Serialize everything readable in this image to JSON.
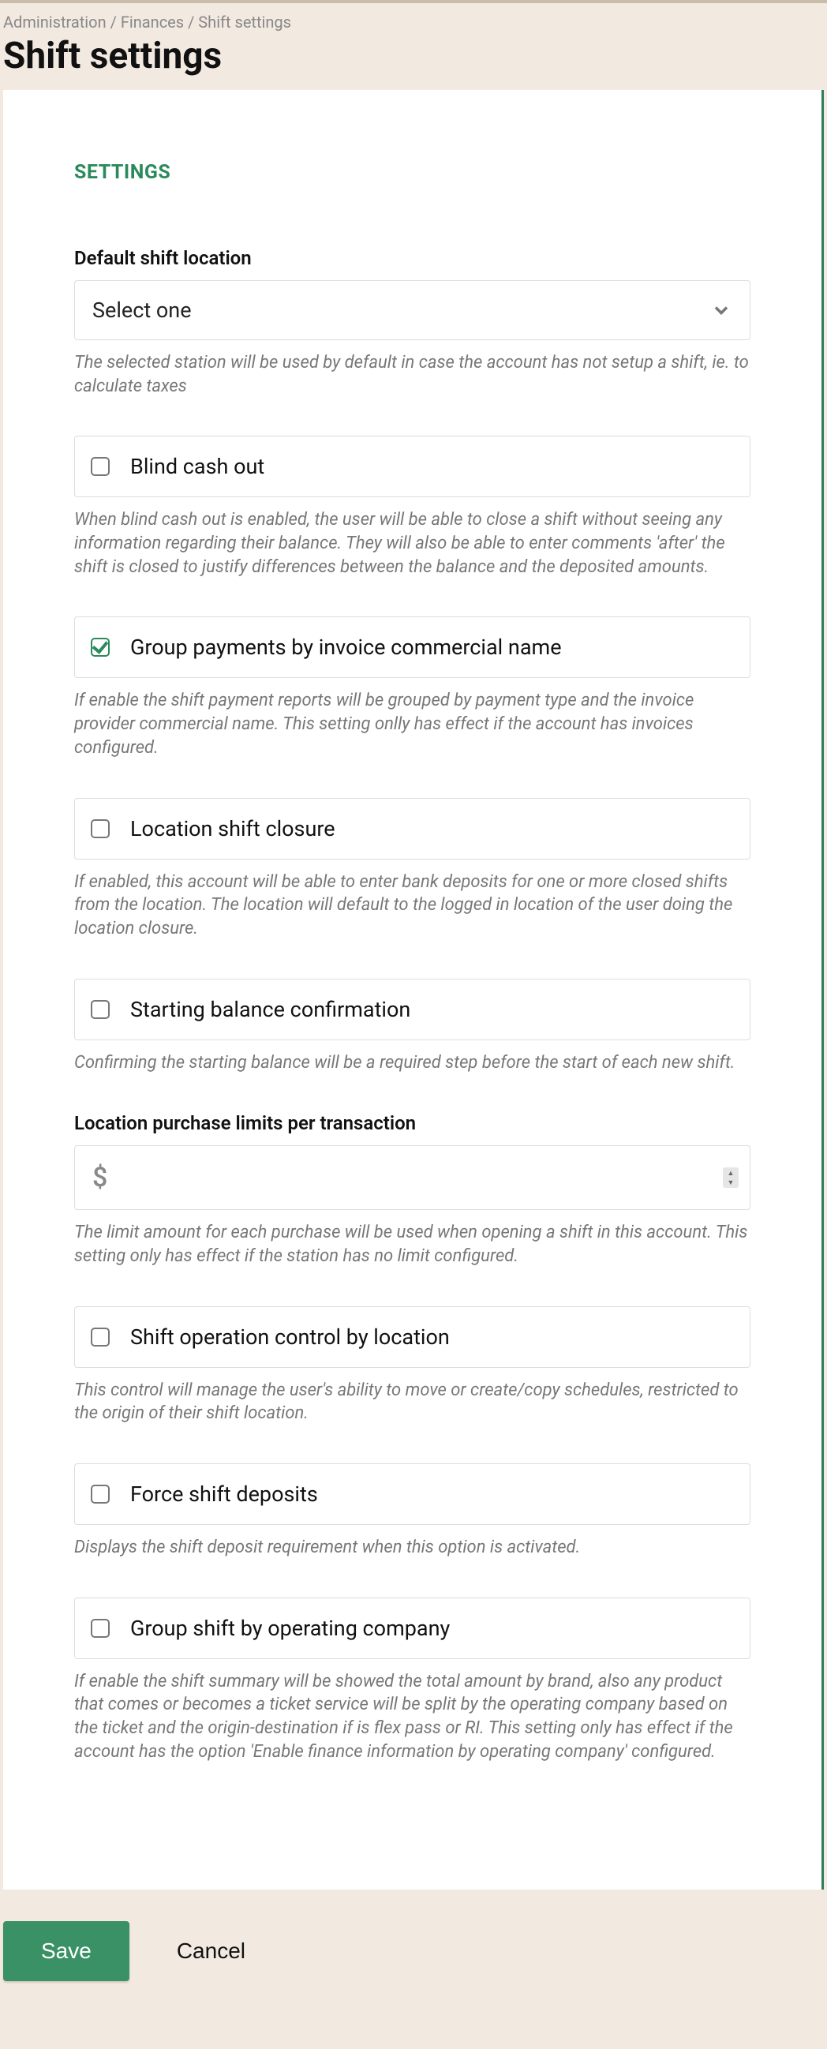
{
  "breadcrumb": {
    "a": "Administration",
    "b": "Finances",
    "c": "Shift settings"
  },
  "page_title": "Shift settings",
  "section_heading": "SETTINGS",
  "fields": {
    "default_location": {
      "label": "Default shift location",
      "placeholder": "Select one",
      "help": "The selected station will be used by default in case the account has not setup a shift, ie. to calculate taxes"
    },
    "blind_cash_out": {
      "label": "Blind cash out",
      "help": "When blind cash out is enabled, the user will be able to close a shift without seeing any information regarding their balance. They will also be able to enter comments 'after' the shift is closed to justify differences between the balance and the deposited amounts."
    },
    "group_payments": {
      "label": "Group payments by invoice commercial name",
      "help": "If enable the shift payment reports will be grouped by payment type and the invoice provider commercial name. This setting onlly has effect if the account has invoices configured."
    },
    "location_closure": {
      "label": "Location shift closure",
      "help": "If enabled, this account will be able to enter bank deposits for one or more closed shifts from the location. The location will default to the logged in location of the user doing the location closure."
    },
    "starting_balance": {
      "label": "Starting balance confirmation",
      "help": "Confirming the starting balance will be a required step before the start of each new shift."
    },
    "purchase_limits": {
      "label": "Location purchase limits per transaction",
      "currency": "$",
      "help": "The limit amount for each purchase will be used when opening a shift in this account. This setting only has effect if the station has no limit configured."
    },
    "op_control": {
      "label": "Shift operation control by location",
      "help": "This control will manage the user's ability to move or create/copy schedules, restricted to the origin of their shift location."
    },
    "force_deposits": {
      "label": "Force shift deposits",
      "help": "Displays the shift deposit requirement when this option is activated."
    },
    "group_by_company": {
      "label": "Group shift by operating company",
      "help": "If enable the shift summary will be showed the total amount by brand, also any product that comes or becomes a ticket service will be split by the operating company based on the ticket and the origin-destination if is flex pass or RI. This setting only has effect if the account has the option 'Enable finance information by operating company' configured."
    }
  },
  "buttons": {
    "save": "Save",
    "cancel": "Cancel"
  }
}
